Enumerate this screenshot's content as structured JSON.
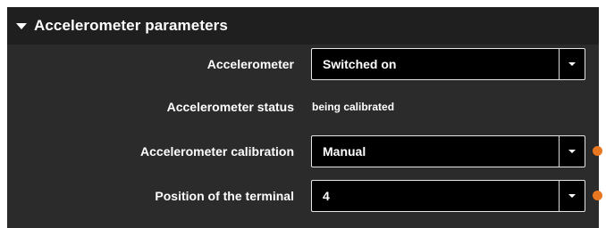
{
  "section": {
    "title": "Accelerometer parameters",
    "caret_icon": "caret-down-icon"
  },
  "rows": [
    {
      "label": "Accelerometer",
      "type": "select",
      "value": "Switched on",
      "modified": false
    },
    {
      "label": "Accelerometer status",
      "type": "text",
      "value": "being calibrated"
    },
    {
      "label": "Accelerometer calibration",
      "type": "select",
      "value": "Manual",
      "modified": true
    },
    {
      "label": "Position of the terminal",
      "type": "select",
      "value": "4",
      "modified": true
    }
  ],
  "colors": {
    "panel_bg": "#2b2b2b",
    "header_bg": "#1f1f1f",
    "modified_dot": "#e87722"
  }
}
